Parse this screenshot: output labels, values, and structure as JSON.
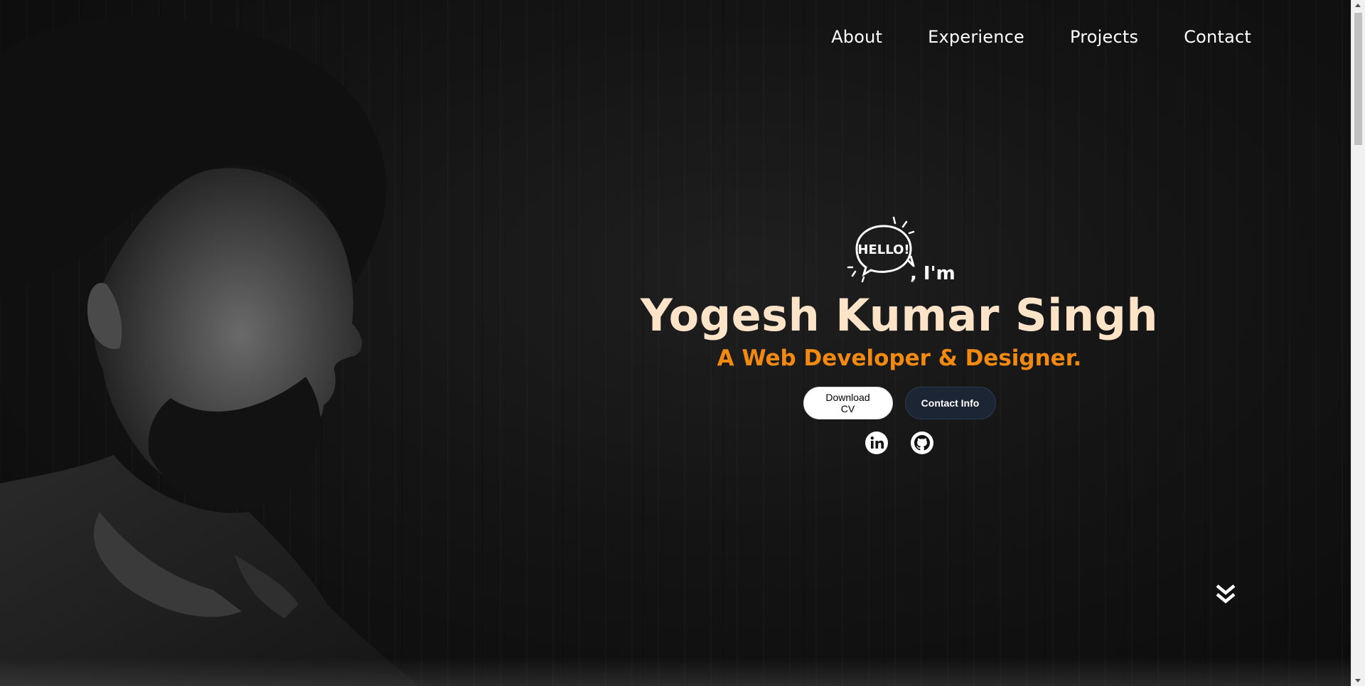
{
  "nav": {
    "items": [
      {
        "label": "About"
      },
      {
        "label": "Experience"
      },
      {
        "label": "Projects"
      },
      {
        "label": "Contact"
      }
    ]
  },
  "hero": {
    "hello_badge": "HELLO!",
    "greeting": ", I'm",
    "name": "Yogesh Kumar Singh",
    "tagline": "A Web Developer & Designer.",
    "download_cv_label": "Download CV",
    "contact_info_label": "Contact Info"
  },
  "socials": {
    "linkedin_icon": "linkedin-icon",
    "github_icon": "github-icon"
  },
  "colors": {
    "name": "#fde4c8",
    "tagline": "#f28a12",
    "background": "#141414",
    "contact_button": "#1c2534"
  }
}
